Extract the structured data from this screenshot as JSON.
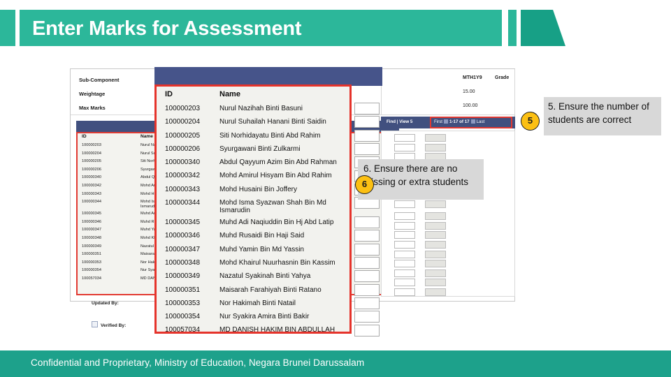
{
  "slide": {
    "title": "Enter Marks for Assessment",
    "footer": "Confidential and Proprietary, Ministry of Education, Negara Brunei Darussalam",
    "accent_green": "#2cb79a",
    "accent_green_dark": "#17a086",
    "footer_green": "#1da18b",
    "highlight_red": "#e23a32",
    "badge_yellow": "#fcc013",
    "grid_header_blue": "#41507f"
  },
  "app": {
    "fields": [
      {
        "label": "Sub-Component"
      },
      {
        "label": "Weightage"
      },
      {
        "label": "Max Marks"
      }
    ],
    "right_columns": [
      "MTH1Y9",
      "Grade"
    ],
    "right_values": [
      "15.00",
      "100.00"
    ],
    "pagination": {
      "find_label": "Find | View 5",
      "first_label": "First",
      "range_label": "1-17 of 17",
      "last_label": "Last"
    },
    "footer_controls": {
      "updated_by": "Updated By:",
      "verified_by": "Verified By:"
    }
  },
  "grid": {
    "headers": {
      "id": "ID",
      "name": "Name"
    },
    "rows": [
      {
        "id": "100000203",
        "name": "Nurul Nazihah Binti Basuni",
        "name2": ""
      },
      {
        "id": "100000204",
        "name": "Nurul Suhailah Hanani Binti Saidin",
        "name2": ""
      },
      {
        "id": "100000205",
        "name": "Siti Norhidayatu Binti Abd Rahim",
        "name2": ""
      },
      {
        "id": "100000206",
        "name": "Syurgawani Binti Zulkarmi",
        "name2": ""
      },
      {
        "id": "100000340",
        "name": "Abdul Qayyum Azim Bin Abd Rahman",
        "name2": ""
      },
      {
        "id": "100000342",
        "name": "Mohd Amirul Hisyam Bin Abd Rahim",
        "name2": ""
      },
      {
        "id": "100000343",
        "name": "Mohd Husaini Bin Joffery",
        "name2": ""
      },
      {
        "id": "100000344",
        "name": "Mohd Isma Syazwan Shah Bin Md",
        "name2": "Ismarudin"
      },
      {
        "id": "100000345",
        "name": "Muhd Adi Naqiuddin Bin Hj Abd Latip",
        "name2": ""
      },
      {
        "id": "100000346",
        "name": "Muhd Rusaidi Bin Haji Said",
        "name2": ""
      },
      {
        "id": "100000347",
        "name": "Muhd Yamin Bin Md Yassin",
        "name2": ""
      },
      {
        "id": "100000348",
        "name": "Mohd Khairul Nuurhasnin Bin Kassim",
        "name2": ""
      },
      {
        "id": "100000349",
        "name": "Nazatul Syakinah Binti Yahya",
        "name2": ""
      },
      {
        "id": "100000351",
        "name": "Maisarah Farahiyah Binti Ratano",
        "name2": ""
      },
      {
        "id": "100000353",
        "name": "Nor Hakimah Binti Natail",
        "name2": ""
      },
      {
        "id": "100000354",
        "name": "Nur Syakira Amira Binti Bakir",
        "name2": ""
      },
      {
        "id": "100057034",
        "name": "MD DANISH HAKIM BIN ABDULLAH",
        "name2": ""
      }
    ]
  },
  "callouts": [
    {
      "number": "5",
      "text": "5. Ensure the number of students are correct"
    },
    {
      "number": "6",
      "text": "6. Ensure there are no missing or extra students"
    }
  ]
}
